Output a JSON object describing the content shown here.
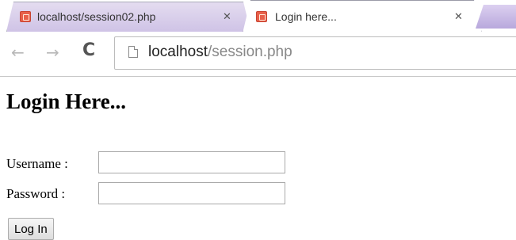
{
  "tabs": [
    {
      "title": "localhost/session02.php",
      "active": false,
      "favicon": "xampp-icon"
    },
    {
      "title": "Login here...",
      "active": true,
      "favicon": "xampp-icon"
    }
  ],
  "address_bar": {
    "host": "localhost",
    "path": "/session.php"
  },
  "page": {
    "heading": "Login Here...",
    "username_label": "Username :",
    "username_value": "",
    "password_label": "Password :",
    "password_value": "",
    "login_button": "Log In"
  },
  "colors": {
    "inactive_tab": "#cfc3e6",
    "favicon": "#e8604a"
  }
}
